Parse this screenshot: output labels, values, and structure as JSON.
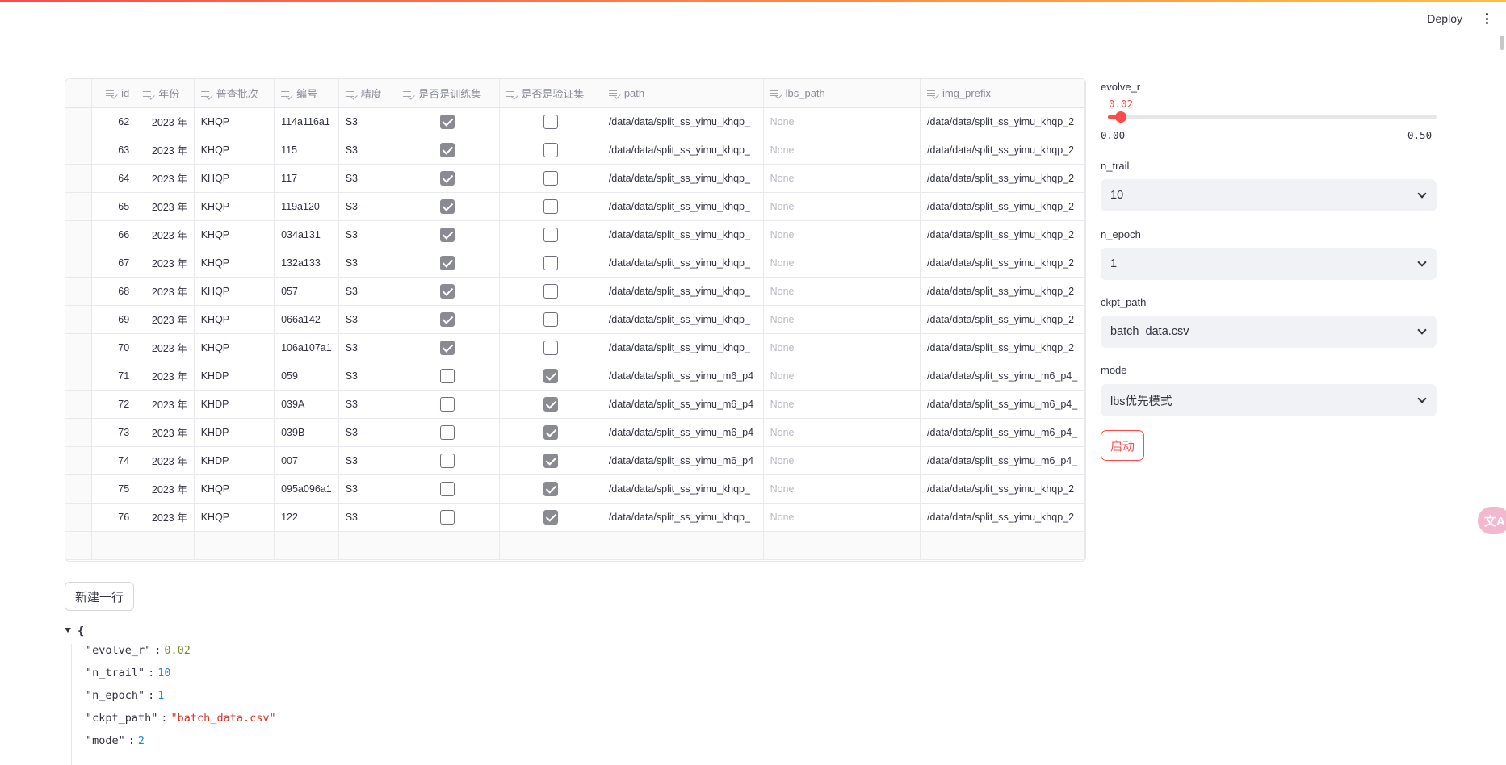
{
  "header": {
    "deploy_label": "Deploy",
    "menu_icon": "more-vertical-icon"
  },
  "table": {
    "columns": [
      "id",
      "年份",
      "普查批次",
      "编号",
      "精度",
      "是否是训练集",
      "是否是验证集",
      "path",
      "lbs_path",
      "img_prefix"
    ],
    "rows": [
      {
        "id": "62",
        "year": "2023 年",
        "batch": "KHQP",
        "code": "114a116a1",
        "precision": "S3",
        "train": true,
        "val": false,
        "path": "/data/data/split_ss_yimu_khqp_",
        "lbs": "None",
        "img": "/data/data/split_ss_yimu_khqp_2"
      },
      {
        "id": "63",
        "year": "2023 年",
        "batch": "KHQP",
        "code": "115",
        "precision": "S3",
        "train": true,
        "val": false,
        "path": "/data/data/split_ss_yimu_khqp_",
        "lbs": "None",
        "img": "/data/data/split_ss_yimu_khqp_2"
      },
      {
        "id": "64",
        "year": "2023 年",
        "batch": "KHQP",
        "code": "117",
        "precision": "S3",
        "train": true,
        "val": false,
        "path": "/data/data/split_ss_yimu_khqp_",
        "lbs": "None",
        "img": "/data/data/split_ss_yimu_khqp_2"
      },
      {
        "id": "65",
        "year": "2023 年",
        "batch": "KHQP",
        "code": "119a120",
        "precision": "S3",
        "train": true,
        "val": false,
        "path": "/data/data/split_ss_yimu_khqp_",
        "lbs": "None",
        "img": "/data/data/split_ss_yimu_khqp_2"
      },
      {
        "id": "66",
        "year": "2023 年",
        "batch": "KHQP",
        "code": "034a131",
        "precision": "S3",
        "train": true,
        "val": false,
        "path": "/data/data/split_ss_yimu_khqp_",
        "lbs": "None",
        "img": "/data/data/split_ss_yimu_khqp_2"
      },
      {
        "id": "67",
        "year": "2023 年",
        "batch": "KHQP",
        "code": "132a133",
        "precision": "S3",
        "train": true,
        "val": false,
        "path": "/data/data/split_ss_yimu_khqp_",
        "lbs": "None",
        "img": "/data/data/split_ss_yimu_khqp_2"
      },
      {
        "id": "68",
        "year": "2023 年",
        "batch": "KHQP",
        "code": "057",
        "precision": "S3",
        "train": true,
        "val": false,
        "path": "/data/data/split_ss_yimu_khqp_",
        "lbs": "None",
        "img": "/data/data/split_ss_yimu_khqp_2"
      },
      {
        "id": "69",
        "year": "2023 年",
        "batch": "KHQP",
        "code": "066a142",
        "precision": "S3",
        "train": true,
        "val": false,
        "path": "/data/data/split_ss_yimu_khqp_",
        "lbs": "None",
        "img": "/data/data/split_ss_yimu_khqp_2"
      },
      {
        "id": "70",
        "year": "2023 年",
        "batch": "KHQP",
        "code": "106a107a1",
        "precision": "S3",
        "train": true,
        "val": false,
        "path": "/data/data/split_ss_yimu_khqp_",
        "lbs": "None",
        "img": "/data/data/split_ss_yimu_khqp_2"
      },
      {
        "id": "71",
        "year": "2023 年",
        "batch": "KHDP",
        "code": "059",
        "precision": "S3",
        "train": false,
        "val": true,
        "path": "/data/data/split_ss_yimu_m6_p4",
        "lbs": "None",
        "img": "/data/data/split_ss_yimu_m6_p4_"
      },
      {
        "id": "72",
        "year": "2023 年",
        "batch": "KHDP",
        "code": "039A",
        "precision": "S3",
        "train": false,
        "val": true,
        "path": "/data/data/split_ss_yimu_m6_p4",
        "lbs": "None",
        "img": "/data/data/split_ss_yimu_m6_p4_"
      },
      {
        "id": "73",
        "year": "2023 年",
        "batch": "KHDP",
        "code": "039B",
        "precision": "S3",
        "train": false,
        "val": true,
        "path": "/data/data/split_ss_yimu_m6_p4",
        "lbs": "None",
        "img": "/data/data/split_ss_yimu_m6_p4_"
      },
      {
        "id": "74",
        "year": "2023 年",
        "batch": "KHDP",
        "code": "007",
        "precision": "S3",
        "train": false,
        "val": true,
        "path": "/data/data/split_ss_yimu_m6_p4",
        "lbs": "None",
        "img": "/data/data/split_ss_yimu_m6_p4_"
      },
      {
        "id": "75",
        "year": "2023 年",
        "batch": "KHQP",
        "code": "095a096a1",
        "precision": "S3",
        "train": false,
        "val": true,
        "path": "/data/data/split_ss_yimu_khqp_",
        "lbs": "None",
        "img": "/data/data/split_ss_yimu_khqp_2"
      },
      {
        "id": "76",
        "year": "2023 年",
        "batch": "KHQP",
        "code": "122",
        "precision": "S3",
        "train": false,
        "val": true,
        "path": "/data/data/split_ss_yimu_khqp_",
        "lbs": "None",
        "img": "/data/data/split_ss_yimu_khqp_2"
      }
    ]
  },
  "add_row_label": "新建一行",
  "json_view": {
    "open_brace": "{",
    "entries": [
      {
        "key": "\"evolve_r\"",
        "value": "0.02",
        "kind": "green"
      },
      {
        "key": "\"n_trail\"",
        "value": "10",
        "kind": "num"
      },
      {
        "key": "\"n_epoch\"",
        "value": "1",
        "kind": "num"
      },
      {
        "key": "\"ckpt_path\"",
        "value": "\"batch_data.csv\"",
        "kind": "str"
      },
      {
        "key": "\"mode\"",
        "value": "2",
        "kind": "num"
      }
    ],
    "colon": ":"
  },
  "controls": {
    "evolve_r": {
      "label": "evolve_r",
      "value": "0.02",
      "min": "0.00",
      "max": "0.50",
      "fraction": 0.04
    },
    "n_trail": {
      "label": "n_trail",
      "value": "10"
    },
    "n_epoch": {
      "label": "n_epoch",
      "value": "1"
    },
    "ckpt_path": {
      "label": "ckpt_path",
      "value": "batch_data.csv"
    },
    "mode": {
      "label": "mode",
      "value": "lbs优先模式"
    },
    "start_label": "启动"
  },
  "colors": {
    "accent": "#ff4b4b",
    "select_bg": "#f0f2f6"
  }
}
